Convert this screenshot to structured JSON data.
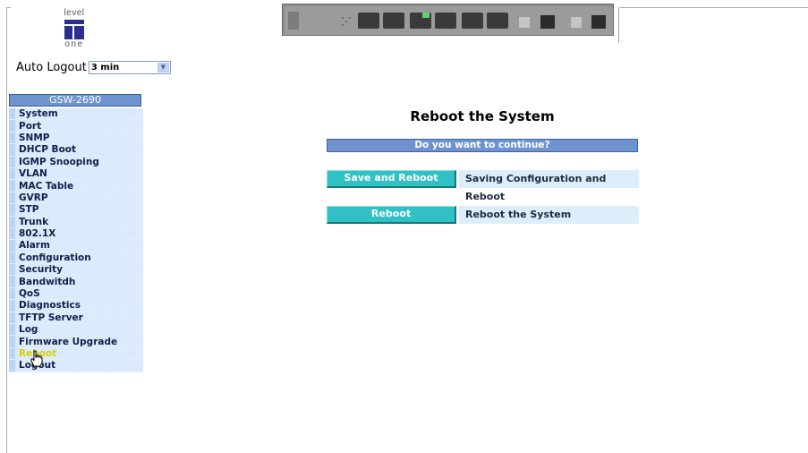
{
  "logo": {
    "top_text": "level",
    "bottom_text": "one"
  },
  "auto_logout": {
    "label": "Auto Logout",
    "selected": "3 min"
  },
  "sidebar": {
    "header": "GSW-2690",
    "items": [
      {
        "label": "System"
      },
      {
        "label": "Port"
      },
      {
        "label": "SNMP"
      },
      {
        "label": "DHCP Boot"
      },
      {
        "label": "IGMP Snooping"
      },
      {
        "label": "VLAN"
      },
      {
        "label": "MAC Table"
      },
      {
        "label": "GVRP"
      },
      {
        "label": "STP"
      },
      {
        "label": "Trunk"
      },
      {
        "label": "802.1X"
      },
      {
        "label": "Alarm"
      },
      {
        "label": "Configuration"
      },
      {
        "label": "Security"
      },
      {
        "label": "Bandwitdh"
      },
      {
        "label": "QoS"
      },
      {
        "label": "Diagnostics"
      },
      {
        "label": "TFTP Server"
      },
      {
        "label": "Log"
      },
      {
        "label": "Firmware Upgrade"
      },
      {
        "label": "Reboot"
      },
      {
        "label": "Logout"
      }
    ],
    "active_item": "Reboot"
  },
  "main": {
    "title": "Reboot the System",
    "question": "Do you want to continue?",
    "actions": [
      {
        "button": "Save and Reboot",
        "description": "Saving Configuration and Reboot"
      },
      {
        "button": "Reboot",
        "description": "Reboot the System"
      }
    ]
  },
  "colors": {
    "menu_header": "#6e94d0",
    "menu_item": "#dbeafc",
    "button": "#31c0c4",
    "active_label": "#d8d000"
  },
  "icons": {
    "cursor": "hand-pointer-icon",
    "dropdown": "chevron-down-icon"
  }
}
